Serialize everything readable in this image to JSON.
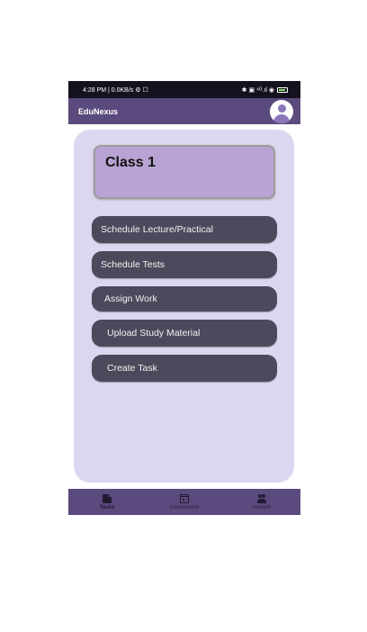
{
  "status_bar": {
    "left_text": "4:28 PM | 0.0KB/s ⚙ ☐",
    "right_text": "✱ ▣ ⁴ᴳ.ıl ◉"
  },
  "app_bar": {
    "title": "EduNexus",
    "avatar_icon": "account-circle-icon"
  },
  "class_card": {
    "title": "Class 1"
  },
  "actions": [
    {
      "label": "Schedule Lecture/Practical"
    },
    {
      "label": "Schedule Tests"
    },
    {
      "label": "Assign Work"
    },
    {
      "label": "Upload Study Material"
    },
    {
      "label": "Create Task"
    }
  ],
  "bottom_nav": [
    {
      "label": "Tasks",
      "icon": "tasks-icon",
      "active": true
    },
    {
      "label": "Attendance",
      "icon": "attendance-icon",
      "active": false
    },
    {
      "label": "People",
      "icon": "people-icon",
      "active": false
    }
  ],
  "colors": {
    "app_bar": "#5b4a7d",
    "panel": "#ddd6f0",
    "class_card": "#b9a3d4",
    "button": "#4a4a5c",
    "status_bar": "#151220"
  }
}
